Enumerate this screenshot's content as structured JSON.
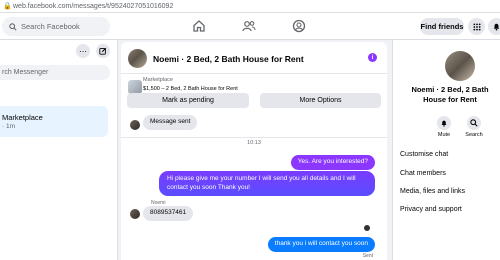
{
  "browser": {
    "url": "web.facebook.com/messages/t/9524027051016092"
  },
  "topbar": {
    "search_placeholder": "Search Facebook",
    "find_friends_label": "Find friends",
    "notification_count": "1"
  },
  "left": {
    "search_placeholder": "rch Messenger",
    "conversation": {
      "title": "Marketplace",
      "subtitle": "· 1m"
    }
  },
  "chat": {
    "name": "Noemi · 2 Bed, 2 Bath House for Rent",
    "badge": "i",
    "marketplace_label": "Marketplace",
    "listing": "$1,500 – 2 Bed, 2 Bath House for Rent",
    "buttons": {
      "mark_pending": "Mark as pending",
      "more_options": "More Options"
    },
    "messages": {
      "sent_notice": "Message sent",
      "time": "10:13",
      "out1": "Yes. Are you interested?",
      "out2": "Hi please give me your number I will send you all details and I will contact you soon Thank you!",
      "sender": "Noemi",
      "in1": "8089537461",
      "out3": "thank you i will contact you soon",
      "status": "Sent"
    }
  },
  "right": {
    "name": "Noemi · 2 Bed, 2 Bath House for Rent",
    "mute": "Mute",
    "search": "Search",
    "items": [
      "Customise chat",
      "Chat members",
      "Media, files and links",
      "Privacy and support"
    ]
  },
  "colors": {
    "accent": "#8a3ffc",
    "outgoing_top": "#8b37ff",
    "outgoing_bottom": "#0a7cff",
    "selected": "#e7f3ff",
    "badge_red": "#e41e3f"
  }
}
